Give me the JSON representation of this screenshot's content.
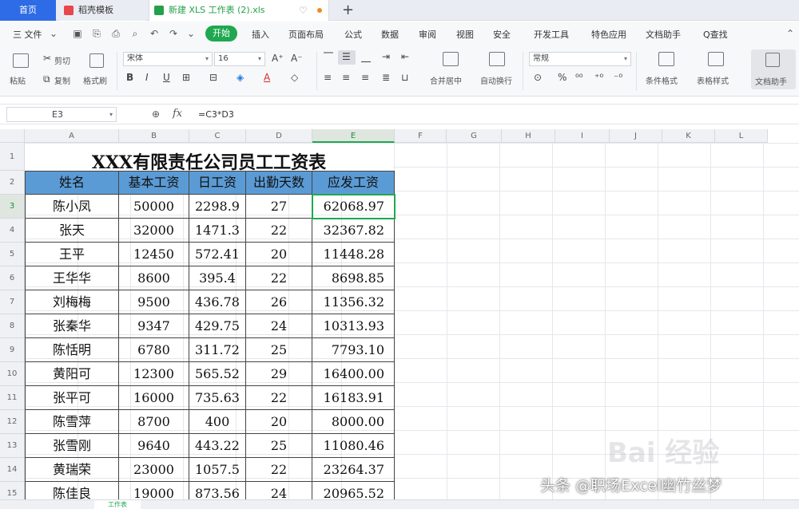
{
  "titlebar": {
    "home_tab": "首页",
    "tab1": "稻壳模板",
    "tab2": "新建 XLS 工作表 (2).xls",
    "new_tab": "+"
  },
  "menubar": {
    "file": "三 文件",
    "start": "开始",
    "items": [
      "插入",
      "页面布局",
      "公式",
      "数据",
      "审阅",
      "视图",
      "安全",
      "开发工具",
      "特色应用",
      "文档助手"
    ],
    "search": "Q查找"
  },
  "ribbon": {
    "paste": "粘贴",
    "cut": "剪切",
    "copy": "复制",
    "format_painter": "格式刷",
    "font_name": "宋体",
    "font_size": "16",
    "merge_center": "合并居中",
    "wrap_text": "自动换行",
    "number_format": "常规",
    "conditional_format": "条件格式",
    "table_style": "表格样式",
    "doc_assistant": "文档助手"
  },
  "formula_bar": {
    "cell_ref": "E3",
    "fx": "fx",
    "formula": "=C3*D3"
  },
  "columns": [
    "A",
    "B",
    "C",
    "D",
    "E",
    "F",
    "G",
    "H",
    "I",
    "J",
    "K",
    "L"
  ],
  "rows": [
    "1",
    "2",
    "3",
    "4",
    "5",
    "6",
    "7",
    "8",
    "9",
    "10",
    "11",
    "12",
    "13",
    "14",
    "15"
  ],
  "sheet": {
    "title": "XXX有限责任公司员工工资表",
    "headers": [
      "姓名",
      "基本工资",
      "日工资",
      "出勤天数",
      "应发工资"
    ],
    "data": [
      [
        "陈小凤",
        "50000",
        "2298.9",
        "27",
        "62068.97"
      ],
      [
        "张天",
        "32000",
        "1471.3",
        "22",
        "32367.82"
      ],
      [
        "王平",
        "12450",
        "572.41",
        "20",
        "11448.28"
      ],
      [
        "王华华",
        "8600",
        "395.4",
        "22",
        "8698.85"
      ],
      [
        "刘梅梅",
        "9500",
        "436.78",
        "26",
        "11356.32"
      ],
      [
        "张秦华",
        "9347",
        "429.75",
        "24",
        "10313.93"
      ],
      [
        "陈恬明",
        "6780",
        "311.72",
        "25",
        "7793.10"
      ],
      [
        "黄阳可",
        "12300",
        "565.52",
        "29",
        "16400.00"
      ],
      [
        "张平可",
        "16000",
        "735.63",
        "22",
        "16183.91"
      ],
      [
        "陈雪萍",
        "8700",
        "400",
        "20",
        "8000.00"
      ],
      [
        "张雪刚",
        "9640",
        "443.22",
        "25",
        "11080.46"
      ],
      [
        "黄瑞荣",
        "23000",
        "1057.5",
        "22",
        "23264.37"
      ],
      [
        "陈佳良",
        "19000",
        "873.56",
        "24",
        "20965.52"
      ]
    ]
  },
  "sheet_tab": "工作表",
  "watermark": "头条 @职场Excel幽竹丝梦",
  "baidu_mark": "Bai 经验",
  "colors": {
    "accent_green": "#1fa84f",
    "header_blue": "#5b9bd5",
    "home_blue": "#2d6ce6"
  }
}
